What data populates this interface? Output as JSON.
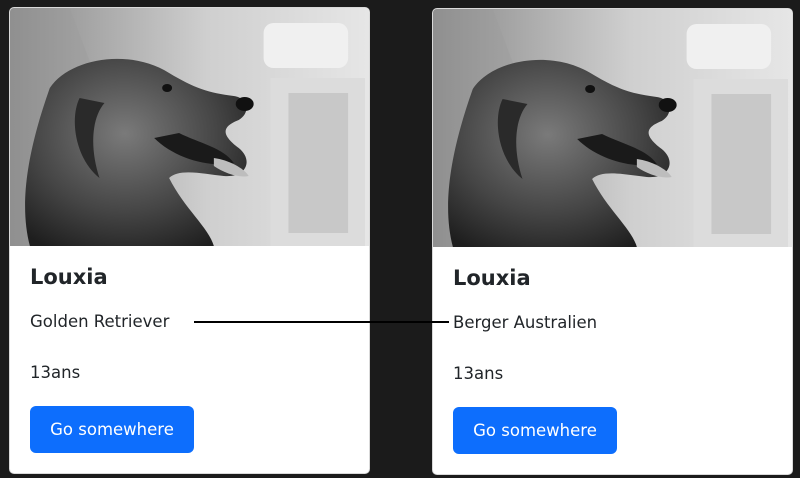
{
  "theme": {
    "page_bg": "#1b1b1b",
    "card_bg": "#ffffff",
    "button_bg": "#0d6efd",
    "connector_color": "#000000"
  },
  "cards": [
    {
      "image": "golden-retriever-dog-photo-grayscale",
      "title": "Louxia",
      "breed": "Golden Retriever",
      "age": "13ans",
      "button_label": "Go somewhere"
    },
    {
      "image": "golden-retriever-dog-photo-grayscale",
      "title": "Louxia",
      "breed": "Berger Australien",
      "age": "13ans",
      "button_label": "Go somewhere"
    }
  ]
}
